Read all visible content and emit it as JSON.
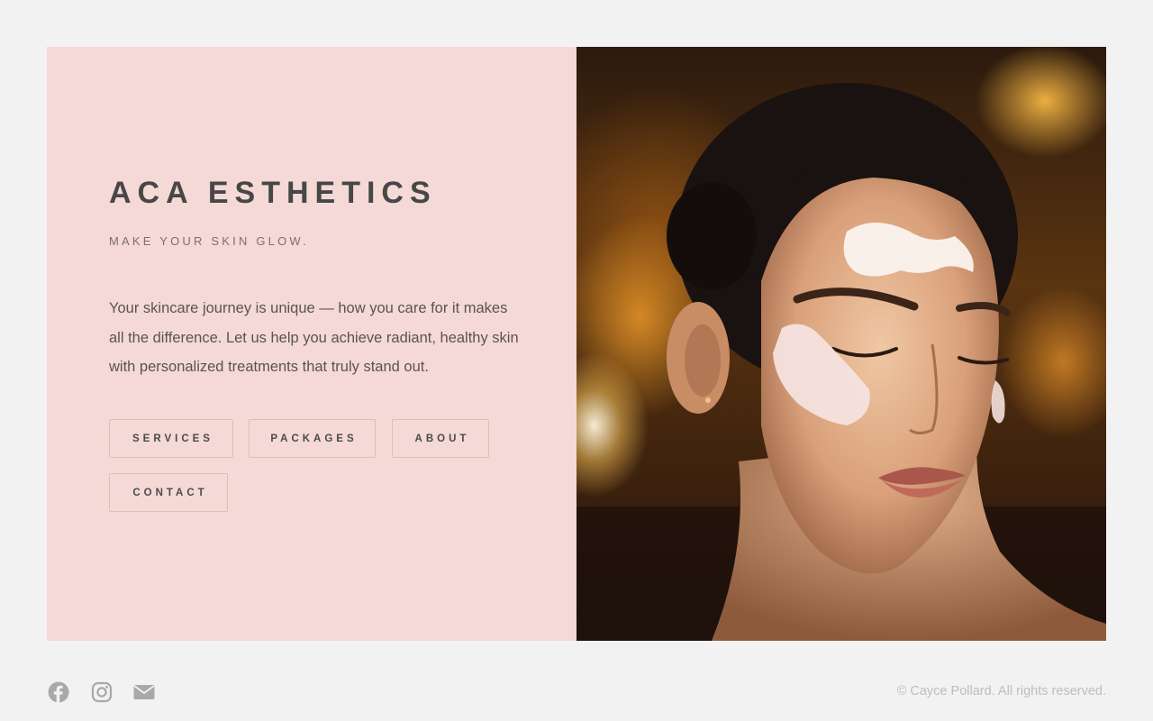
{
  "hero": {
    "brand": "ACA ESTHETICS",
    "tagline": "MAKE YOUR SKIN GLOW.",
    "intro": "Your skincare journey is unique — how you care for it makes all the difference. Let us help you achieve radiant, healthy skin with personalized treatments that truly stand out."
  },
  "nav": {
    "services": "SERVICES",
    "packages": "PACKAGES",
    "about": "ABOUT",
    "contact": "CONTACT"
  },
  "footer": {
    "social_icons": [
      "facebook-icon",
      "instagram-icon",
      "mail-icon"
    ],
    "copyright": "© Cayce Pollard. All rights reserved."
  },
  "colors": {
    "page_background": "#f2f2f2",
    "panel_background": "#f5d9d6",
    "heading_text": "#474747",
    "button_border": "#e0bdb9",
    "icon_gray": "#a9a9a9"
  }
}
